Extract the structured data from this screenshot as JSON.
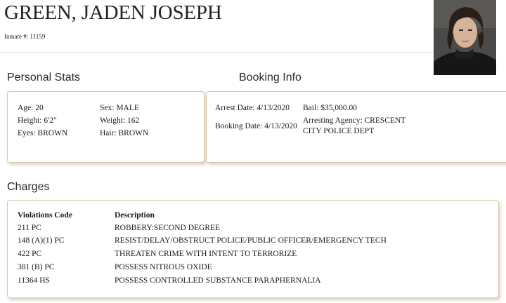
{
  "header": {
    "name": "GREEN, JADEN JOSEPH",
    "inmate_label": "Inmate #: 11159"
  },
  "sections": {
    "personal_stats": "Personal Stats",
    "booking_info": "Booking Info",
    "charges": "Charges"
  },
  "personal": {
    "age": "Age: 20",
    "sex": "Sex: MALE",
    "height": "Height: 6'2\"",
    "weight": "Weight: 162",
    "eyes": "Eyes: BROWN",
    "hair": "Hair: BROWN"
  },
  "booking": {
    "arrest_date": "Arrest Date: 4/13/2020",
    "bail": "Bail: $35,000.00",
    "booking_date": "Booking Date: 4/13/2020",
    "arresting_agency": "Arresting Agency: CRESCENT CITY POLICE DEPT"
  },
  "charges": {
    "headers": {
      "code": "Violations Code",
      "description": "Description"
    },
    "rows": [
      {
        "code": "211 PC",
        "description": "ROBBERY:SECOND DEGREE"
      },
      {
        "code": "148 (A)(1) PC",
        "description": "RESIST/DELAY/OBSTRUCT POLICE/PUBLIC OFFICER/EMERGENCY TECH"
      },
      {
        "code": "422 PC",
        "description": "THREATEN CRIME WITH INTENT TO TERRORIZE"
      },
      {
        "code": "381 (B) PC",
        "description": "POSSESS NITROUS OXIDE"
      },
      {
        "code": "11364 HS",
        "description": "POSSESS CONTROLLED SUBSTANCE PARAPHERNALIA"
      }
    ]
  }
}
